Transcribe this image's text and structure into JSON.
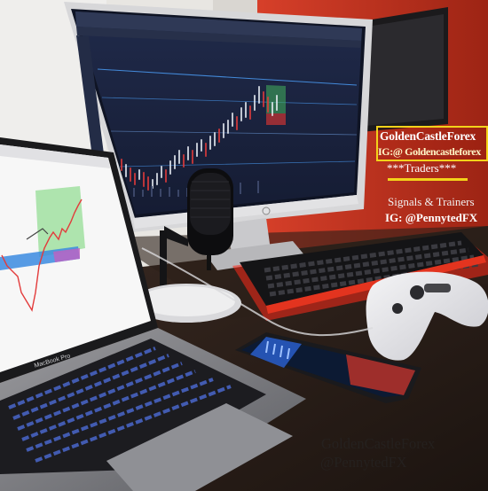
{
  "overlay": {
    "brand_name": "GoldenCastleForex",
    "brand_ig": "IG:@ Goldencastleforex",
    "traders": "***Traders***",
    "signals": "Signals & Trainers",
    "signals_ig": "IG: @PennytedFX"
  },
  "watermark": {
    "line1": "GoldenCastleForex",
    "line2": "@PennytedFX"
  },
  "laptop": {
    "brand_label": "MacBook Pro"
  },
  "colors": {
    "wall_red": "#c8331d",
    "accent_yellow": "#f3d21a",
    "chart_bg": "#1b2340",
    "candle_up": "#e9eef5",
    "candle_down": "#e33b3b",
    "zone_green": "#7ad37a",
    "zone_blue": "#3b8be0",
    "keyboard_glow": "#ff3a2a"
  },
  "icons": [
    "microphone-icon",
    "gamepad-icon",
    "smartphone-icon",
    "monitor-icon",
    "laptop-icon",
    "keyboard-icon"
  ]
}
